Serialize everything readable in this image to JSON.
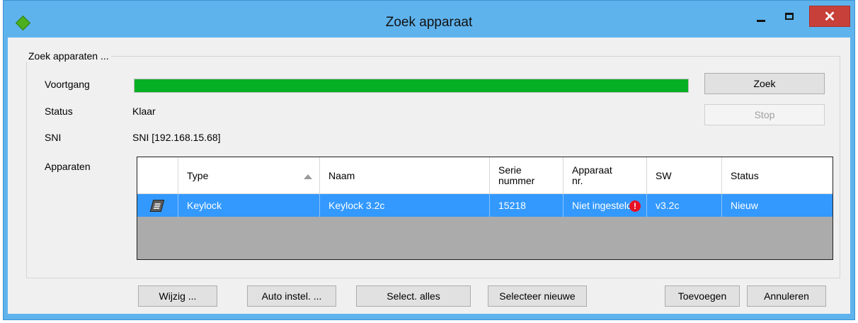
{
  "window": {
    "title": "Zoek apparaat",
    "close_glyph": "✕"
  },
  "group": {
    "title": "Zoek apparaten ..."
  },
  "fields": {
    "progress_label": "Voortgang",
    "progress_value": 1.0,
    "status_label": "Status",
    "status_value": "Klaar",
    "sni_label": "SNI",
    "sni_value": "SNI [192.168.15.68]",
    "devices_label": "Apparaten"
  },
  "side_buttons": {
    "search": "Zoek",
    "stop": "Stop"
  },
  "table": {
    "columns": {
      "type": "Type",
      "name": "Naam",
      "serial": "Serie\nnummer",
      "device_nr": "Apparaat\nnr.",
      "sw": "SW",
      "status": "Status"
    },
    "rows": [
      {
        "icon": "keypad-device-icon",
        "type": "Keylock",
        "name": "Keylock 3.2c",
        "serial": "15218",
        "device_nr": "Niet ingesteld",
        "sw": "v3.2c",
        "status": "Nieuw"
      }
    ]
  },
  "bottom_buttons": {
    "edit": "Wijzig ...",
    "auto": "Auto instel. ...",
    "select_all": "Select. alles",
    "select_new": "Selecteer nieuwe",
    "add": "Toevoegen",
    "cancel": "Annuleren"
  },
  "colors": {
    "titlebar": "#5fb3ed",
    "close_button": "#c7403a",
    "progress": "#06b025",
    "selection": "#3399ff",
    "warning": "#e81123"
  }
}
